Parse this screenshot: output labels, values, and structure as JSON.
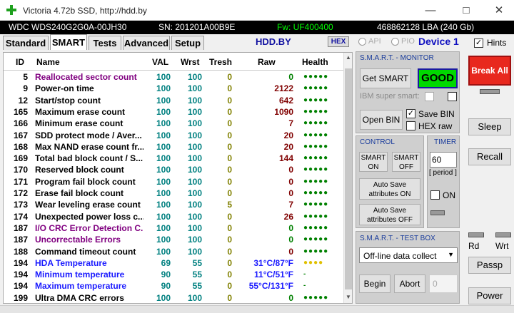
{
  "window": {
    "title": "Victoria 4.72b SSD, http://hdd.by"
  },
  "info": {
    "model": "WDC WDS240G2G0A-00JH30",
    "serial": "SN: 201201A00B9E",
    "firmware": "Fw: UF400400",
    "capacity": "468862128 LBA (240 Gb)"
  },
  "tabs": [
    "Standard",
    "SMART",
    "Tests",
    "Advanced",
    "Setup"
  ],
  "toolbar": {
    "hddby": "HDD.BY",
    "hex": "HEX",
    "api": "API",
    "pio": "PIO",
    "device": "Device 1",
    "hints": "Hints"
  },
  "smart_table": {
    "headers": [
      "ID",
      "Name",
      "VAL",
      "Wrst",
      "Tresh",
      "Raw",
      "Health"
    ],
    "rows": [
      {
        "id": "5",
        "name": "Reallocated sector count",
        "val": "100",
        "wrst": "100",
        "tresh": "0",
        "raw": "0",
        "health": "●●●●●",
        "name_color": "#800080",
        "raw_color": "#008000",
        "health_color": "#008000"
      },
      {
        "id": "9",
        "name": "Power-on time",
        "val": "100",
        "wrst": "100",
        "tresh": "0",
        "raw": "2122",
        "health": "●●●●●",
        "name_color": "#000000",
        "raw_color": "#800000",
        "health_color": "#008000"
      },
      {
        "id": "12",
        "name": "Start/stop count",
        "val": "100",
        "wrst": "100",
        "tresh": "0",
        "raw": "642",
        "health": "●●●●●",
        "name_color": "#000000",
        "raw_color": "#800000",
        "health_color": "#008000"
      },
      {
        "id": "165",
        "name": "Maximum erase count",
        "val": "100",
        "wrst": "100",
        "tresh": "0",
        "raw": "1090",
        "health": "●●●●●",
        "name_color": "#000000",
        "raw_color": "#800000",
        "health_color": "#008000"
      },
      {
        "id": "166",
        "name": "Minimum erase count",
        "val": "100",
        "wrst": "100",
        "tresh": "0",
        "raw": "7",
        "health": "●●●●●",
        "name_color": "#000000",
        "raw_color": "#800000",
        "health_color": "#008000"
      },
      {
        "id": "167",
        "name": "SDD protect mode / Aver...",
        "val": "100",
        "wrst": "100",
        "tresh": "0",
        "raw": "20",
        "health": "●●●●●",
        "name_color": "#000000",
        "raw_color": "#800000",
        "health_color": "#008000"
      },
      {
        "id": "168",
        "name": "Max NAND erase count fr...",
        "val": "100",
        "wrst": "100",
        "tresh": "0",
        "raw": "20",
        "health": "●●●●●",
        "name_color": "#000000",
        "raw_color": "#800000",
        "health_color": "#008000"
      },
      {
        "id": "169",
        "name": "Total bad block count / S...",
        "val": "100",
        "wrst": "100",
        "tresh": "0",
        "raw": "144",
        "health": "●●●●●",
        "name_color": "#000000",
        "raw_color": "#800000",
        "health_color": "#008000"
      },
      {
        "id": "170",
        "name": "Reserved block count",
        "val": "100",
        "wrst": "100",
        "tresh": "0",
        "raw": "0",
        "health": "●●●●●",
        "name_color": "#000000",
        "raw_color": "#800000",
        "health_color": "#008000"
      },
      {
        "id": "171",
        "name": "Program fail block count",
        "val": "100",
        "wrst": "100",
        "tresh": "0",
        "raw": "0",
        "health": "●●●●●",
        "name_color": "#000000",
        "raw_color": "#800000",
        "health_color": "#008000"
      },
      {
        "id": "172",
        "name": "Erase fail block count",
        "val": "100",
        "wrst": "100",
        "tresh": "0",
        "raw": "0",
        "health": "●●●●●",
        "name_color": "#000000",
        "raw_color": "#800000",
        "health_color": "#008000"
      },
      {
        "id": "173",
        "name": "Wear leveling erase count",
        "val": "100",
        "wrst": "100",
        "tresh": "5",
        "raw": "7",
        "health": "●●●●●",
        "name_color": "#000000",
        "raw_color": "#800000",
        "health_color": "#008000"
      },
      {
        "id": "174",
        "name": "Unexpected power loss c...",
        "val": "100",
        "wrst": "100",
        "tresh": "0",
        "raw": "26",
        "health": "●●●●●",
        "name_color": "#000000",
        "raw_color": "#800000",
        "health_color": "#008000"
      },
      {
        "id": "187",
        "name": "I/O CRC Error Detection C...",
        "val": "100",
        "wrst": "100",
        "tresh": "0",
        "raw": "0",
        "health": "●●●●●",
        "name_color": "#800080",
        "raw_color": "#008000",
        "health_color": "#008000"
      },
      {
        "id": "187",
        "name": "Uncorrectable Errors",
        "val": "100",
        "wrst": "100",
        "tresh": "0",
        "raw": "0",
        "health": "●●●●●",
        "name_color": "#800080",
        "raw_color": "#008000",
        "health_color": "#008000"
      },
      {
        "id": "188",
        "name": "Command timeout count",
        "val": "100",
        "wrst": "100",
        "tresh": "0",
        "raw": "0",
        "health": "●●●●●",
        "name_color": "#000000",
        "raw_color": "#800000",
        "health_color": "#008000"
      },
      {
        "id": "194",
        "name": "HDA Temperature",
        "val": "69",
        "wrst": "55",
        "tresh": "0",
        "raw": "31°C/87°F",
        "health": "●●●●",
        "name_color": "#1a1aff",
        "raw_color": "#1a1aff",
        "health_color": "#e0c000"
      },
      {
        "id": "194",
        "name": "Minimum temperature",
        "val": "90",
        "wrst": "55",
        "tresh": "0",
        "raw": "11°C/51°F",
        "health": "-",
        "name_color": "#1a1aff",
        "raw_color": "#1a1aff",
        "health_color": "#008000"
      },
      {
        "id": "194",
        "name": "Maximum temperature",
        "val": "90",
        "wrst": "55",
        "tresh": "0",
        "raw": "55°C/131°F",
        "health": "-",
        "name_color": "#1a1aff",
        "raw_color": "#1a1aff",
        "health_color": "#008000"
      },
      {
        "id": "199",
        "name": "Ultra DMA CRC errors",
        "val": "100",
        "wrst": "100",
        "tresh": "0",
        "raw": "0",
        "health": "●●●●●",
        "name_color": "#000000",
        "raw_color": "#008000",
        "health_color": "#008000"
      }
    ]
  },
  "monitor": {
    "title": "S.M.A.R.T. - MONITOR",
    "get_smart": "Get SMART",
    "status": "GOOD",
    "ibm": "IBM super smart:",
    "open_bin": "Open BIN",
    "save_bin": "Save BIN",
    "hex_raw": "HEX raw"
  },
  "control": {
    "title": "CONTROL",
    "smart_on": "SMART ON",
    "smart_off": "SMART OFF",
    "autosave_on": "Auto Save attributes ON",
    "autosave_off": "Auto Save attributes OFF"
  },
  "timer": {
    "title": "TIMER",
    "value": "60",
    "period": "[ period ]",
    "on": "ON"
  },
  "testbox": {
    "title": "S.M.A.R.T. - TEST BOX",
    "selected": "Off-line data collect",
    "begin": "Begin",
    "abort": "Abort",
    "value": "0"
  },
  "side": {
    "break_all": "Break All",
    "sleep": "Sleep",
    "recall": "Recall",
    "rd": "Rd",
    "wrt": "Wrt",
    "passp": "Passp",
    "power": "Power"
  },
  "colors": {
    "good": "#00d800",
    "break": "#e8281e",
    "header_blue": "#1010a0"
  }
}
